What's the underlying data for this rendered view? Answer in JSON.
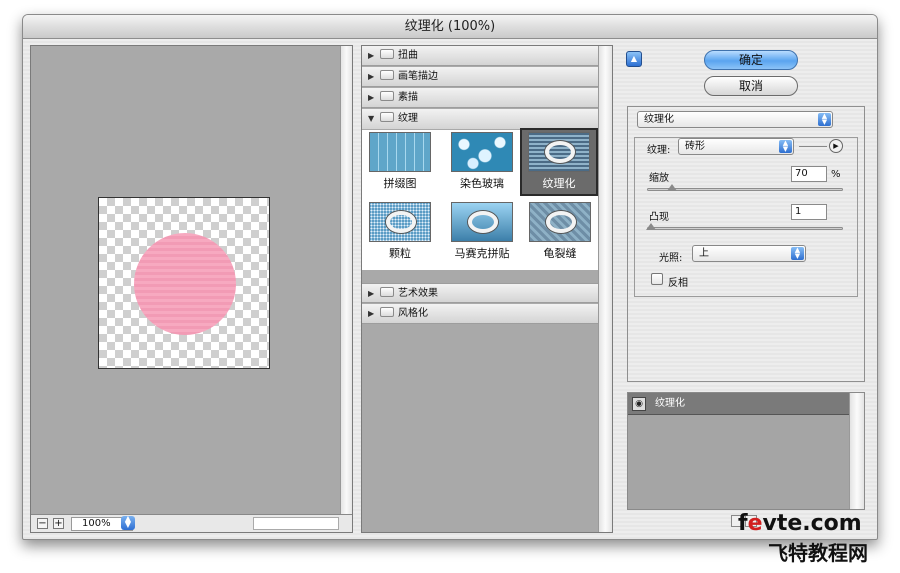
{
  "window": {
    "title": "纹理化 (100%)"
  },
  "preview": {
    "zoom": "100%",
    "zoom_out": "−",
    "zoom_in": "+"
  },
  "gallery": {
    "categories_top": [
      {
        "label": "扭曲",
        "expanded": false
      },
      {
        "label": "画笔描边",
        "expanded": false
      },
      {
        "label": "素描",
        "expanded": false
      },
      {
        "label": "纹理",
        "expanded": true
      }
    ],
    "filters": [
      {
        "label": "拼缀图"
      },
      {
        "label": "染色玻璃"
      },
      {
        "label": "纹理化",
        "selected": true
      },
      {
        "label": "颗粒"
      },
      {
        "label": "马赛克拼贴"
      },
      {
        "label": "龟裂缝"
      }
    ],
    "categories_bottom": [
      {
        "label": "艺术效果",
        "expanded": false
      },
      {
        "label": "风格化",
        "expanded": false
      }
    ]
  },
  "buttons": {
    "ok": "确定",
    "cancel": "取消"
  },
  "settings": {
    "filter_select": "纹理化",
    "texture_label": "纹理:",
    "texture_value": "砖形",
    "scaling_label": "缩放",
    "scaling_value": "70",
    "scaling_unit": "%",
    "relief_label": "凸现",
    "relief_value": "1",
    "light_label": "光照:",
    "light_value": "上",
    "invert_label": "反相",
    "invert_checked": false,
    "scaling_level_fraction": 0.13,
    "relief_level_fraction": 0.02
  },
  "layers": [
    {
      "label": "纹理化",
      "visible": true
    }
  ],
  "watermark": {
    "line1_pre": "f",
    "line1_e": "e",
    "line1_post": "vte.com",
    "line2": "飞特教程网"
  },
  "colors": {
    "accent": "#5aa4ef",
    "preview_bg": "#a9a9a9",
    "circle": "#f29bb5"
  }
}
